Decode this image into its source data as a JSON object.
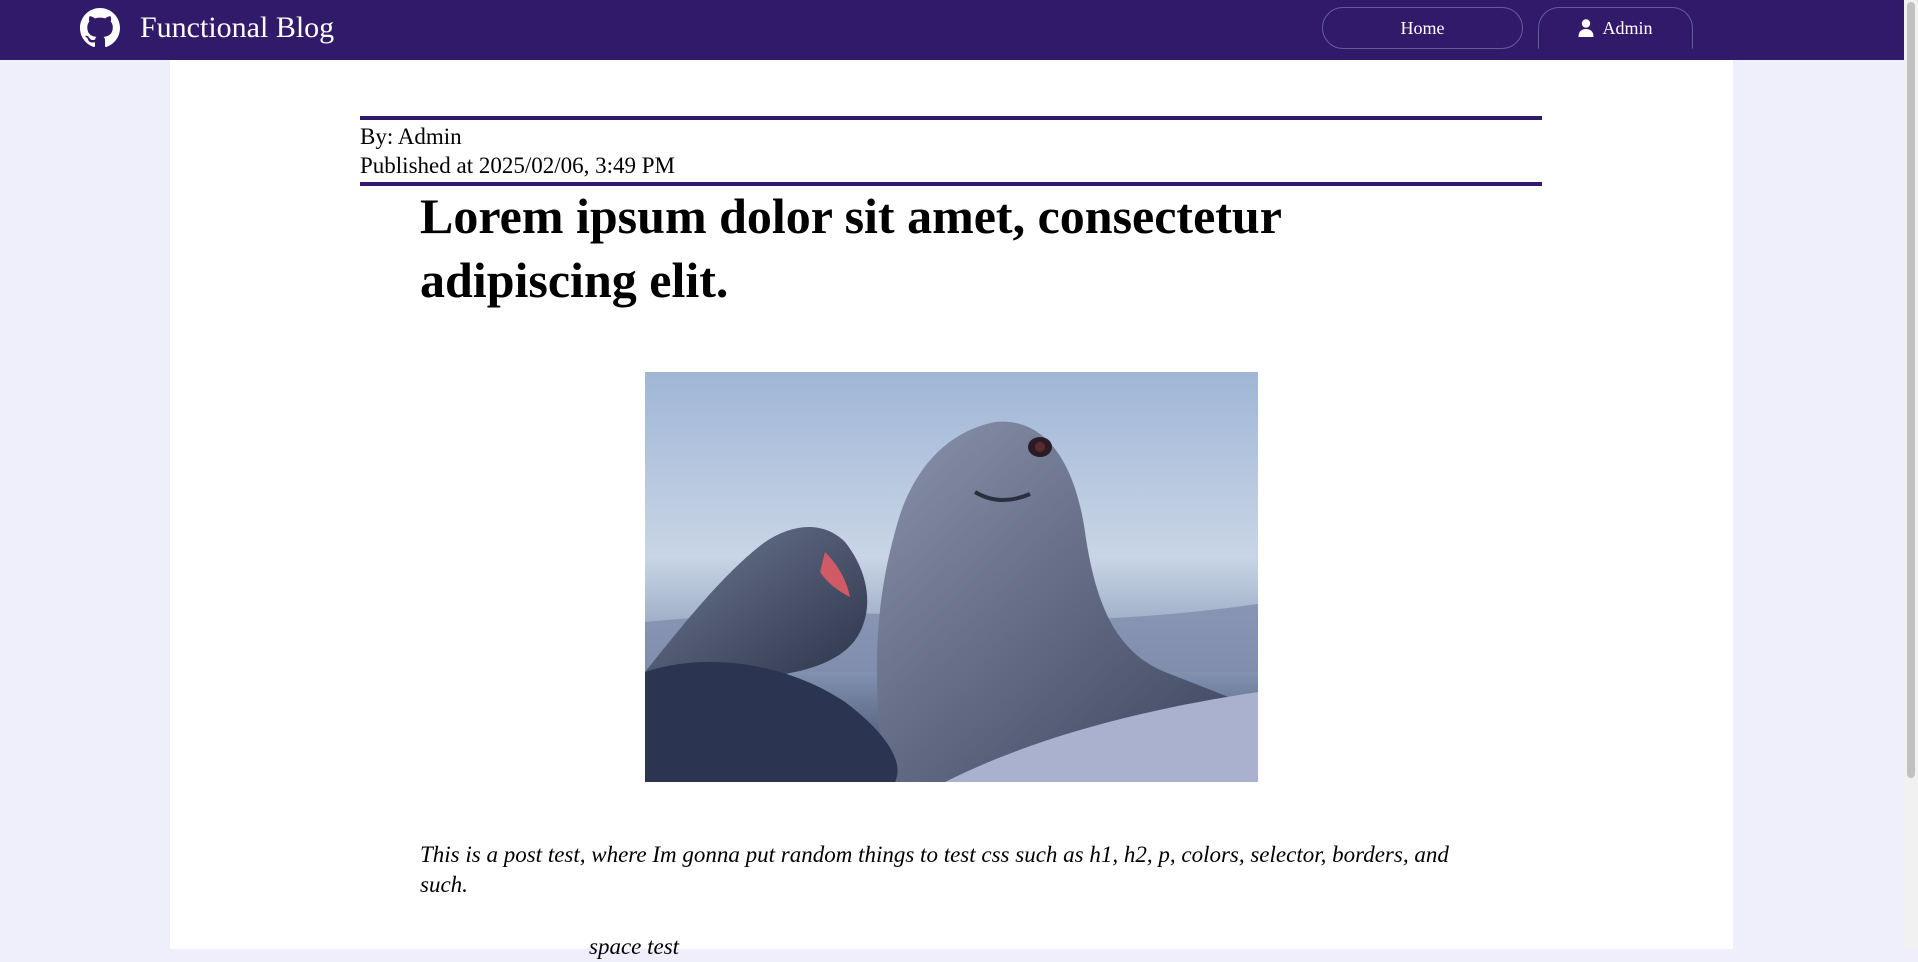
{
  "header": {
    "brand_title": "Functional Blog",
    "brand_icon": "github-icon",
    "nav": {
      "home_label": "Home",
      "admin_label": "Admin",
      "admin_icon": "user-icon"
    }
  },
  "post": {
    "author_line": "By: Admin",
    "published_line": "Published at 2025/02/06, 3:49 PM",
    "title": "Lorem ipsum dolor sit amet, consectetur adipiscing elit.",
    "image_alt": "Two elephant seals",
    "body_text": "This is a post test, where Im gonna put random things to test css such as h1, h2, p, colors, selector, borders, and such.",
    "space_test_text": "space test"
  },
  "colors": {
    "navbar": "#321a6b",
    "page_background": "#efeefb",
    "rule": "#321a6b"
  }
}
